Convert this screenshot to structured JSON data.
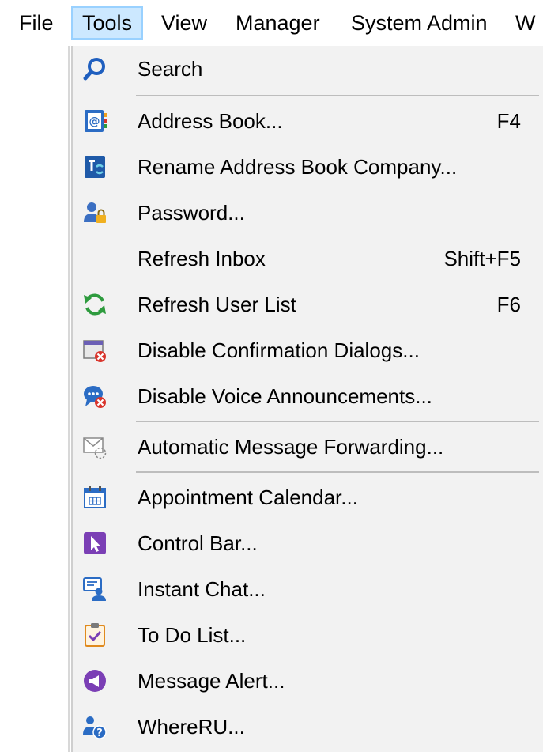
{
  "menubar": {
    "items": [
      {
        "label": "File"
      },
      {
        "label": "Tools"
      },
      {
        "label": "View"
      },
      {
        "label": "Manager"
      },
      {
        "label": "System Admin"
      },
      {
        "label": "W"
      }
    ]
  },
  "tools_menu": {
    "items": [
      {
        "label": "Search",
        "shortcut": "",
        "icon": "search-icon"
      },
      {
        "label": "Address Book...",
        "shortcut": "F4",
        "icon": "address-book-icon"
      },
      {
        "label": "Rename Address Book Company...",
        "shortcut": "",
        "icon": "rename-address-book-icon"
      },
      {
        "label": "Password...",
        "shortcut": "",
        "icon": "user-lock-icon"
      },
      {
        "label": "Refresh Inbox",
        "shortcut": "Shift+F5",
        "icon": ""
      },
      {
        "label": "Refresh User List",
        "shortcut": "F6",
        "icon": "refresh-icon"
      },
      {
        "label": "Disable Confirmation Dialogs...",
        "shortcut": "",
        "icon": "dialog-disable-icon"
      },
      {
        "label": "Disable Voice Announcements...",
        "shortcut": "",
        "icon": "voice-disable-icon"
      },
      {
        "label": "Automatic Message Forwarding...",
        "shortcut": "",
        "icon": "envelope-forward-icon"
      },
      {
        "label": "Appointment Calendar...",
        "shortcut": "",
        "icon": "calendar-icon"
      },
      {
        "label": "Control Bar...",
        "shortcut": "",
        "icon": "cursor-icon"
      },
      {
        "label": "Instant Chat...",
        "shortcut": "",
        "icon": "chat-user-icon"
      },
      {
        "label": "To Do List...",
        "shortcut": "",
        "icon": "clipboard-check-icon"
      },
      {
        "label": "Message Alert...",
        "shortcut": "",
        "icon": "megaphone-icon"
      },
      {
        "label": "WhereRU...",
        "shortcut": "",
        "icon": "users-question-icon"
      }
    ]
  },
  "colors": {
    "highlight_bg": "#cce8ff",
    "highlight_border": "#99d1ff",
    "menu_bg": "#f2f2f2",
    "accent_blue": "#1f5fbf",
    "accent_green": "#2e9b3e",
    "accent_red": "#d9342b",
    "accent_purple": "#7b3fb5"
  }
}
